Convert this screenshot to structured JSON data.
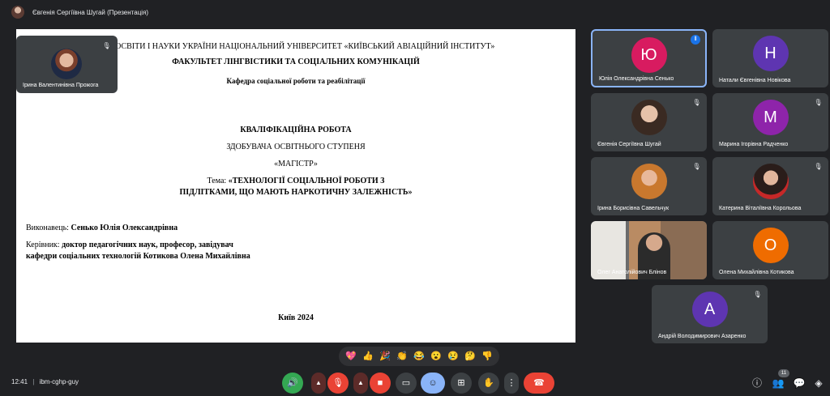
{
  "topbar": {
    "title": "Євгенія Сергіївна Шугай (Презентація)",
    "avatar_icon": "presenter-avatar"
  },
  "slide": {
    "l1": "ТВО ОСВІТИ І НАУКИ УКРАЇНИ  НАЦІОНАЛЬНИЙ  УНІВЕРСИТЕТ «КИЇВСЬКИЙ АВІАЦІЙНИЙ ІНСТИТУТ»",
    "l2": "ФАКУЛЬТЕТ ЛІНГВІСТИКИ ТА СОЦІАЛЬНИХ КОМУНІКАЦІЙ",
    "l3": "Кафедра соціальної роботи та реабілітації",
    "l4": "КВАЛІФІКАЦІЙНА РОБОТА",
    "l5": "ЗДОБУВАЧА ОСВІТНЬОГО СТУПЕНЯ",
    "l6": "«МАГІСТР»",
    "l7_prefix": "Тема: ",
    "l7_bold": "«ТЕХНОЛОГІЇ СОЦІАЛЬНОЇ РОБОТИ З",
    "l8": "ПІДЛІТКАМИ, ЩО МАЮТЬ НАРКОТИЧНУ ЗАЛЕЖНІСТЬ»",
    "l9_prefix": "Виконавець: ",
    "l9_bold": "Сенько Юлія Олександрівна",
    "l10_prefix": "Керівник: ",
    "l10_bold": "доктор педагогічних наук, професор, завідувач",
    "l11": "кафедри соціальних технологій Котикова Олена Михайлівна",
    "l12": "Київ 2024"
  },
  "self_tile": {
    "name": "Ірина Валентинівна Прожога"
  },
  "participants": [
    {
      "name": "Юлія Олександрівна Сенько",
      "initial": "Ю",
      "color": "#d81b60"
    },
    {
      "name": "Натали Євгенівна Новікова",
      "initial": "Н",
      "color": "#5e35b1"
    },
    {
      "name": "Євгенія Сергіївна Шугай"
    },
    {
      "name": "Марина Ігорівна Радченко",
      "initial": "М",
      "color": "#8e24aa"
    },
    {
      "name": "Ірина Борисівна Савельчук"
    },
    {
      "name": "Катерина Віталіївна Корольова"
    },
    {
      "name": "Олег Анатолійович Блінов"
    },
    {
      "name": "Олена Михайлівна Котикова",
      "initial": "О",
      "color": "#ef6c00"
    },
    {
      "name": "Андрій Володимирович Азаренко",
      "initial": "А",
      "color": "#5e35b1"
    }
  ],
  "reactions": [
    "💖",
    "👍",
    "🎉",
    "👏",
    "😂",
    "😮",
    "😢",
    "🤔",
    "👎"
  ],
  "bottombar": {
    "time": "12:41",
    "separator": "|",
    "meeting_code": "ibm-cghp-guy",
    "participants_count": "11"
  },
  "colors": {
    "background": "#202124",
    "tile": "#3c4043",
    "active_border": "#8ab4f8",
    "danger": "#ea4335",
    "green": "#34a853"
  }
}
